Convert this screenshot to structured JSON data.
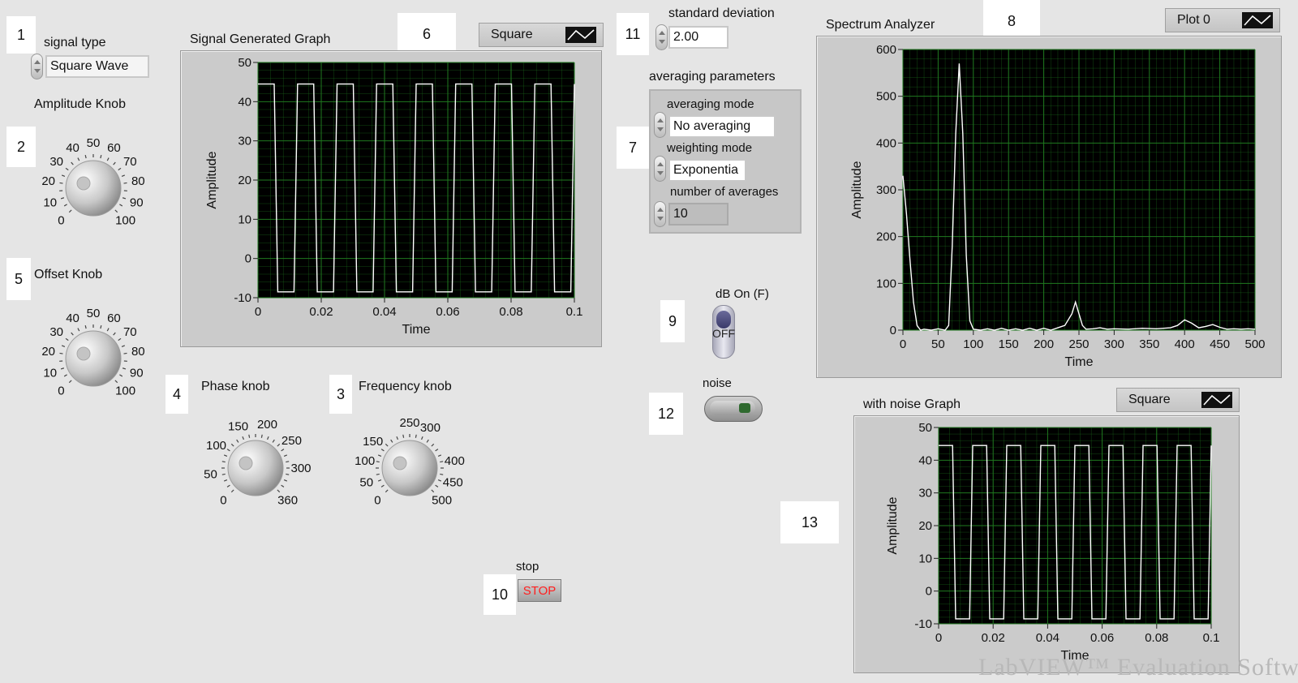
{
  "controls": {
    "signal_type": {
      "label": "signal type",
      "value": "Square Wave"
    },
    "amplitude_knob": {
      "label": "Amplitude Knob",
      "scale": [
        "0",
        "10",
        "20",
        "30",
        "40",
        "50",
        "60",
        "70",
        "80",
        "90",
        "100"
      ]
    },
    "offset_knob": {
      "label": "Offset Knob",
      "scale": [
        "0",
        "10",
        "20",
        "30",
        "40",
        "50",
        "60",
        "70",
        "80",
        "90",
        "100"
      ]
    },
    "phase_knob": {
      "label": "Phase knob",
      "scale": [
        "0",
        "50",
        "100",
        "150",
        "200",
        "250",
        "300",
        "360"
      ]
    },
    "frequency_knob": {
      "label": "Frequency knob",
      "scale": [
        "0",
        "50",
        "100",
        "150",
        "250",
        "300",
        "400",
        "450",
        "500"
      ]
    },
    "standard_deviation": {
      "label": "standard deviation",
      "value": "2.00"
    },
    "averaging": {
      "label": "averaging parameters",
      "averaging_mode_label": "averaging mode",
      "averaging_mode_value": "No averaging",
      "weighting_mode_label": "weighting mode",
      "weighting_mode_value": "Exponentia",
      "number_of_averages_label": "number of averages",
      "number_of_averages_value": "10"
    },
    "db_on": {
      "label": "dB On (F)",
      "state": "OFF"
    },
    "noise": {
      "label": "noise"
    },
    "stop": {
      "label": "stop",
      "button_text": "STOP"
    }
  },
  "graphs": {
    "signal": {
      "title": "Signal Generated Graph",
      "legend": "Square"
    },
    "spectrum": {
      "title": "Spectrum Analyzer",
      "legend": "Plot 0"
    },
    "noise": {
      "title": "with noise Graph",
      "legend": "Square"
    }
  },
  "callouts": [
    "1",
    "2",
    "3",
    "4",
    "5",
    "6",
    "7",
    "8",
    "9",
    "10",
    "11",
    "12",
    "13"
  ],
  "watermark": "LabVIEW™ Evaluation Software",
  "colors": {
    "plot_bg": "#000000",
    "grid": "#1f7a1f",
    "trace": "#ffffff",
    "panel": "#e5e5e5",
    "stop_red": "#ff2020"
  },
  "chart_data": [
    {
      "type": "line",
      "title": "Signal Generated Graph",
      "xlabel": "Time",
      "ylabel": "Amplitude",
      "xlim": [
        0,
        0.1
      ],
      "ylim": [
        -10,
        50
      ],
      "xticks": [
        "0",
        "0.02",
        "0.04",
        "0.06",
        "0.08",
        "0.1"
      ],
      "yticks": [
        "50",
        "40",
        "30",
        "20",
        "10",
        "0",
        "-10"
      ],
      "series": [
        {
          "name": "Square",
          "waveform": "square",
          "high": 44.5,
          "low": -8.5,
          "period": 0.0125,
          "start": "high"
        }
      ]
    },
    {
      "type": "line",
      "title": "Spectrum Analyzer",
      "xlabel": "Time",
      "ylabel": "Amplitude",
      "xlim": [
        0,
        500
      ],
      "ylim": [
        0,
        600
      ],
      "xticks": [
        "0",
        "50",
        "100",
        "150",
        "200",
        "250",
        "300",
        "350",
        "400",
        "450",
        "500"
      ],
      "yticks": [
        "600",
        "500",
        "400",
        "300",
        "200",
        "100",
        "0"
      ],
      "series": [
        {
          "name": "Plot 0",
          "x": [
            0,
            5,
            10,
            15,
            20,
            25,
            30,
            40,
            50,
            60,
            65,
            70,
            75,
            80,
            85,
            90,
            95,
            100,
            110,
            120,
            130,
            140,
            150,
            160,
            170,
            180,
            190,
            200,
            210,
            220,
            230,
            240,
            245,
            250,
            255,
            260,
            270,
            280,
            290,
            300,
            320,
            340,
            360,
            380,
            390,
            400,
            410,
            420,
            430,
            440,
            450,
            460,
            470,
            480,
            490,
            500
          ],
          "y": [
            330,
            250,
            150,
            60,
            10,
            0,
            2,
            0,
            3,
            0,
            10,
            180,
            420,
            570,
            420,
            160,
            20,
            2,
            0,
            3,
            0,
            4,
            0,
            3,
            0,
            4,
            0,
            4,
            0,
            5,
            10,
            35,
            60,
            35,
            10,
            2,
            3,
            5,
            2,
            3,
            2,
            4,
            3,
            5,
            10,
            22,
            15,
            5,
            8,
            12,
            6,
            2,
            3,
            2,
            3,
            2
          ]
        }
      ]
    },
    {
      "type": "line",
      "title": "with noise Graph",
      "xlabel": "Time",
      "ylabel": "Amplitude",
      "xlim": [
        0,
        0.1
      ],
      "ylim": [
        -10,
        50
      ],
      "xticks": [
        "0",
        "0.02",
        "0.04",
        "0.06",
        "0.08",
        "0.1"
      ],
      "yticks": [
        "50",
        "40",
        "30",
        "20",
        "10",
        "0",
        "-10"
      ],
      "series": [
        {
          "name": "Square",
          "waveform": "square",
          "high": 44.5,
          "low": -8.5,
          "period": 0.0125,
          "start": "high"
        }
      ]
    }
  ]
}
